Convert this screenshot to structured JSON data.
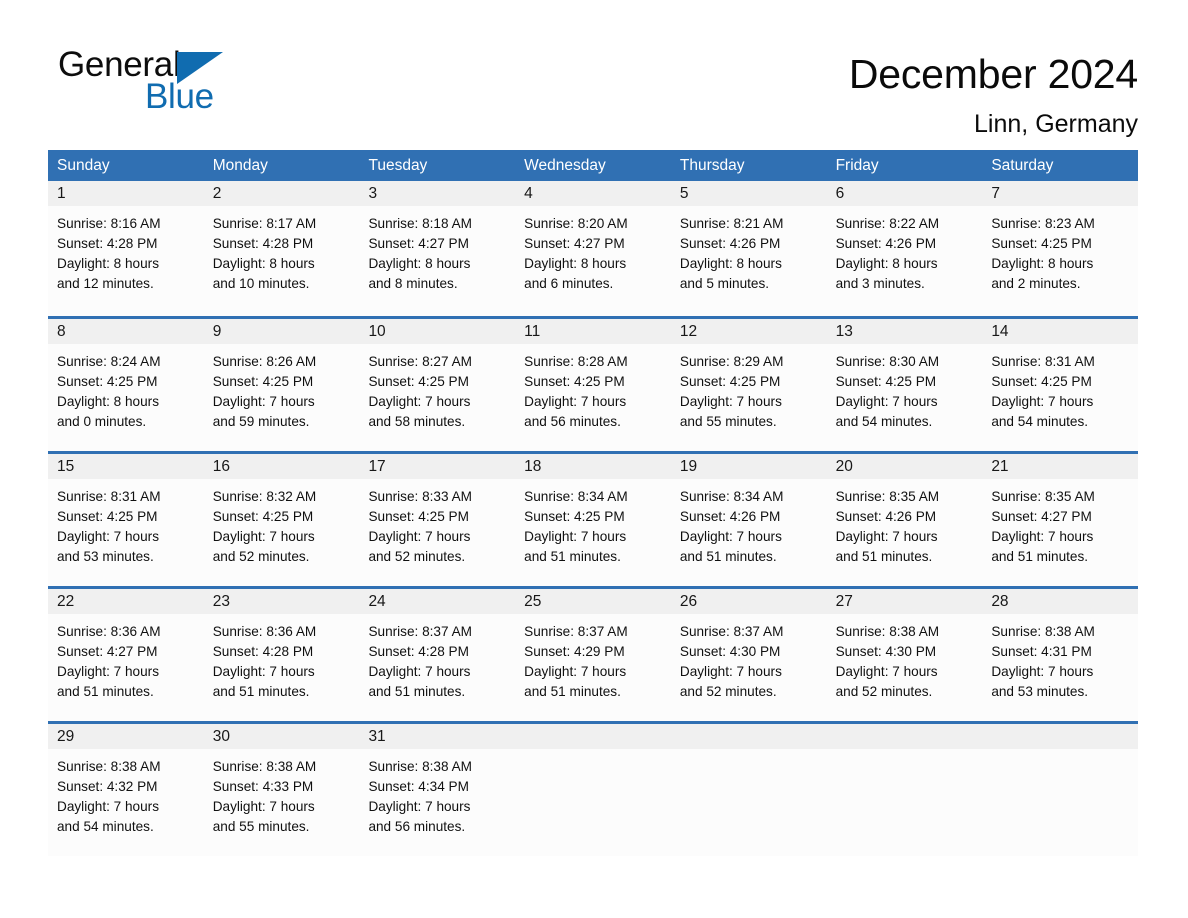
{
  "brand": {
    "word_one": "General",
    "word_two": "Blue",
    "triangle_color": "#106cb0",
    "text_color": "#0d0d0d"
  },
  "header": {
    "title": "December 2024",
    "location": "Linn, Germany",
    "accent_color": "#3070b3"
  },
  "calendar": {
    "weekday_headers": [
      "Sunday",
      "Monday",
      "Tuesday",
      "Wednesday",
      "Thursday",
      "Friday",
      "Saturday"
    ],
    "weeks": [
      [
        {
          "day": "1",
          "sunrise": "Sunrise: 8:16 AM",
          "sunset": "Sunset: 4:28 PM",
          "daylight_1": "Daylight: 8 hours",
          "daylight_2": "and 12 minutes."
        },
        {
          "day": "2",
          "sunrise": "Sunrise: 8:17 AM",
          "sunset": "Sunset: 4:28 PM",
          "daylight_1": "Daylight: 8 hours",
          "daylight_2": "and 10 minutes."
        },
        {
          "day": "3",
          "sunrise": "Sunrise: 8:18 AM",
          "sunset": "Sunset: 4:27 PM",
          "daylight_1": "Daylight: 8 hours",
          "daylight_2": "and 8 minutes."
        },
        {
          "day": "4",
          "sunrise": "Sunrise: 8:20 AM",
          "sunset": "Sunset: 4:27 PM",
          "daylight_1": "Daylight: 8 hours",
          "daylight_2": "and 6 minutes."
        },
        {
          "day": "5",
          "sunrise": "Sunrise: 8:21 AM",
          "sunset": "Sunset: 4:26 PM",
          "daylight_1": "Daylight: 8 hours",
          "daylight_2": "and 5 minutes."
        },
        {
          "day": "6",
          "sunrise": "Sunrise: 8:22 AM",
          "sunset": "Sunset: 4:26 PM",
          "daylight_1": "Daylight: 8 hours",
          "daylight_2": "and 3 minutes."
        },
        {
          "day": "7",
          "sunrise": "Sunrise: 8:23 AM",
          "sunset": "Sunset: 4:25 PM",
          "daylight_1": "Daylight: 8 hours",
          "daylight_2": "and 2 minutes."
        }
      ],
      [
        {
          "day": "8",
          "sunrise": "Sunrise: 8:24 AM",
          "sunset": "Sunset: 4:25 PM",
          "daylight_1": "Daylight: 8 hours",
          "daylight_2": "and 0 minutes."
        },
        {
          "day": "9",
          "sunrise": "Sunrise: 8:26 AM",
          "sunset": "Sunset: 4:25 PM",
          "daylight_1": "Daylight: 7 hours",
          "daylight_2": "and 59 minutes."
        },
        {
          "day": "10",
          "sunrise": "Sunrise: 8:27 AM",
          "sunset": "Sunset: 4:25 PM",
          "daylight_1": "Daylight: 7 hours",
          "daylight_2": "and 58 minutes."
        },
        {
          "day": "11",
          "sunrise": "Sunrise: 8:28 AM",
          "sunset": "Sunset: 4:25 PM",
          "daylight_1": "Daylight: 7 hours",
          "daylight_2": "and 56 minutes."
        },
        {
          "day": "12",
          "sunrise": "Sunrise: 8:29 AM",
          "sunset": "Sunset: 4:25 PM",
          "daylight_1": "Daylight: 7 hours",
          "daylight_2": "and 55 minutes."
        },
        {
          "day": "13",
          "sunrise": "Sunrise: 8:30 AM",
          "sunset": "Sunset: 4:25 PM",
          "daylight_1": "Daylight: 7 hours",
          "daylight_2": "and 54 minutes."
        },
        {
          "day": "14",
          "sunrise": "Sunrise: 8:31 AM",
          "sunset": "Sunset: 4:25 PM",
          "daylight_1": "Daylight: 7 hours",
          "daylight_2": "and 54 minutes."
        }
      ],
      [
        {
          "day": "15",
          "sunrise": "Sunrise: 8:31 AM",
          "sunset": "Sunset: 4:25 PM",
          "daylight_1": "Daylight: 7 hours",
          "daylight_2": "and 53 minutes."
        },
        {
          "day": "16",
          "sunrise": "Sunrise: 8:32 AM",
          "sunset": "Sunset: 4:25 PM",
          "daylight_1": "Daylight: 7 hours",
          "daylight_2": "and 52 minutes."
        },
        {
          "day": "17",
          "sunrise": "Sunrise: 8:33 AM",
          "sunset": "Sunset: 4:25 PM",
          "daylight_1": "Daylight: 7 hours",
          "daylight_2": "and 52 minutes."
        },
        {
          "day": "18",
          "sunrise": "Sunrise: 8:34 AM",
          "sunset": "Sunset: 4:25 PM",
          "daylight_1": "Daylight: 7 hours",
          "daylight_2": "and 51 minutes."
        },
        {
          "day": "19",
          "sunrise": "Sunrise: 8:34 AM",
          "sunset": "Sunset: 4:26 PM",
          "daylight_1": "Daylight: 7 hours",
          "daylight_2": "and 51 minutes."
        },
        {
          "day": "20",
          "sunrise": "Sunrise: 8:35 AM",
          "sunset": "Sunset: 4:26 PM",
          "daylight_1": "Daylight: 7 hours",
          "daylight_2": "and 51 minutes."
        },
        {
          "day": "21",
          "sunrise": "Sunrise: 8:35 AM",
          "sunset": "Sunset: 4:27 PM",
          "daylight_1": "Daylight: 7 hours",
          "daylight_2": "and 51 minutes."
        }
      ],
      [
        {
          "day": "22",
          "sunrise": "Sunrise: 8:36 AM",
          "sunset": "Sunset: 4:27 PM",
          "daylight_1": "Daylight: 7 hours",
          "daylight_2": "and 51 minutes."
        },
        {
          "day": "23",
          "sunrise": "Sunrise: 8:36 AM",
          "sunset": "Sunset: 4:28 PM",
          "daylight_1": "Daylight: 7 hours",
          "daylight_2": "and 51 minutes."
        },
        {
          "day": "24",
          "sunrise": "Sunrise: 8:37 AM",
          "sunset": "Sunset: 4:28 PM",
          "daylight_1": "Daylight: 7 hours",
          "daylight_2": "and 51 minutes."
        },
        {
          "day": "25",
          "sunrise": "Sunrise: 8:37 AM",
          "sunset": "Sunset: 4:29 PM",
          "daylight_1": "Daylight: 7 hours",
          "daylight_2": "and 51 minutes."
        },
        {
          "day": "26",
          "sunrise": "Sunrise: 8:37 AM",
          "sunset": "Sunset: 4:30 PM",
          "daylight_1": "Daylight: 7 hours",
          "daylight_2": "and 52 minutes."
        },
        {
          "day": "27",
          "sunrise": "Sunrise: 8:38 AM",
          "sunset": "Sunset: 4:30 PM",
          "daylight_1": "Daylight: 7 hours",
          "daylight_2": "and 52 minutes."
        },
        {
          "day": "28",
          "sunrise": "Sunrise: 8:38 AM",
          "sunset": "Sunset: 4:31 PM",
          "daylight_1": "Daylight: 7 hours",
          "daylight_2": "and 53 minutes."
        }
      ],
      [
        {
          "day": "29",
          "sunrise": "Sunrise: 8:38 AM",
          "sunset": "Sunset: 4:32 PM",
          "daylight_1": "Daylight: 7 hours",
          "daylight_2": "and 54 minutes."
        },
        {
          "day": "30",
          "sunrise": "Sunrise: 8:38 AM",
          "sunset": "Sunset: 4:33 PM",
          "daylight_1": "Daylight: 7 hours",
          "daylight_2": "and 55 minutes."
        },
        {
          "day": "31",
          "sunrise": "Sunrise: 8:38 AM",
          "sunset": "Sunset: 4:34 PM",
          "daylight_1": "Daylight: 7 hours",
          "daylight_2": "and 56 minutes."
        },
        {
          "day": "",
          "sunrise": "",
          "sunset": "",
          "daylight_1": "",
          "daylight_2": "",
          "empty": true
        },
        {
          "day": "",
          "sunrise": "",
          "sunset": "",
          "daylight_1": "",
          "daylight_2": "",
          "empty": true
        },
        {
          "day": "",
          "sunrise": "",
          "sunset": "",
          "daylight_1": "",
          "daylight_2": "",
          "empty": true
        },
        {
          "day": "",
          "sunrise": "",
          "sunset": "",
          "daylight_1": "",
          "daylight_2": "",
          "empty": true
        }
      ]
    ]
  }
}
